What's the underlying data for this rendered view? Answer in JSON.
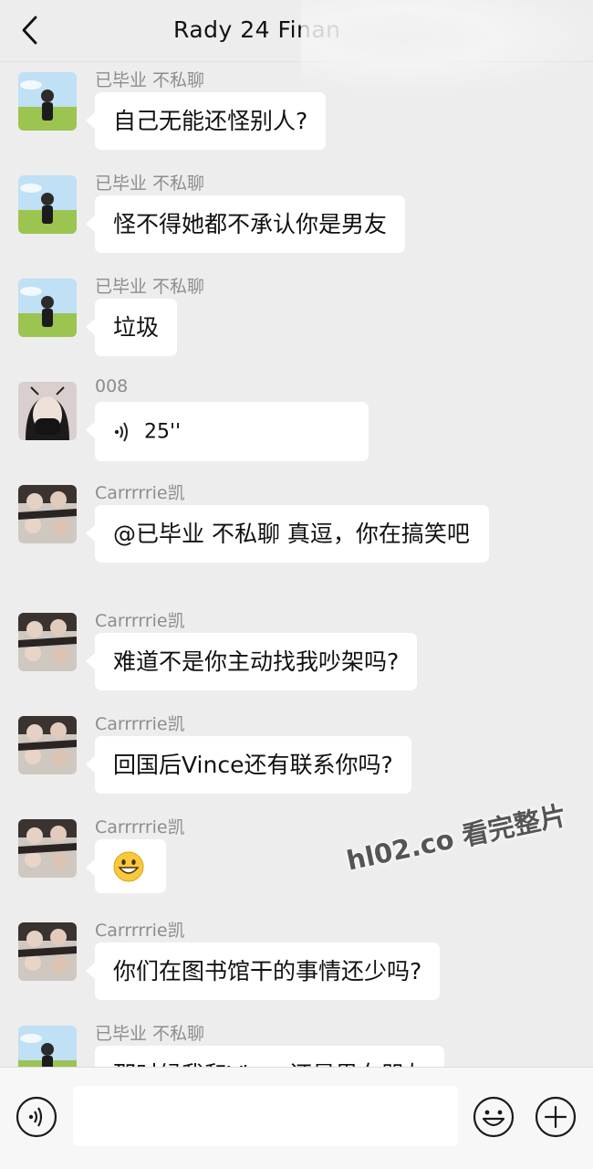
{
  "header": {
    "title": "Rady 24 Finan",
    "back_icon": "chevron-left-icon"
  },
  "messages": [
    {
      "sender": "已毕业 不私聊",
      "text": "自己无能还怪别人?",
      "avatar": "girl-meadow-avatar"
    },
    {
      "sender": "已毕业 不私聊",
      "text": "怪不得她都不承认你是男友",
      "avatar": "girl-meadow-avatar"
    },
    {
      "sender": "已毕业 不私聊",
      "text": "垃圾",
      "avatar": "girl-meadow-avatar"
    },
    {
      "sender": "008",
      "voice_duration": "25''",
      "avatar": "girl-mask-avatar",
      "type": "voice"
    },
    {
      "sender": "Carrrrrie凯",
      "text": "@已毕业 不私聊 真逗，你在搞笑吧",
      "avatar": "group-photo-avatar"
    },
    {
      "sender": "Carrrrrie凯",
      "text": "难道不是你主动找我吵架吗?",
      "avatar": "group-photo-avatar"
    },
    {
      "sender": "Carrrrrie凯",
      "text": "回国后Vince还有联系你吗?",
      "avatar": "group-photo-avatar"
    },
    {
      "sender": "Carrrrrie凯",
      "emoji": "grinning-face",
      "avatar": "group-photo-avatar",
      "type": "emoji"
    },
    {
      "sender": "Carrrrrie凯",
      "text": "你们在图书馆干的事情还少吗?",
      "avatar": "group-photo-avatar"
    },
    {
      "sender": "已毕业 不私聊",
      "text": "那时候我和Vince还是男女朋友",
      "avatar": "girl-meadow-avatar"
    }
  ],
  "watermark": "hl02.co 看完整片",
  "input_bar": {
    "voice_icon": "voice-mode-icon",
    "input_value": "",
    "emoji_icon": "emoji-icon",
    "plus_icon": "plus-icon"
  },
  "colors": {
    "background": "#ededed",
    "bubble": "#ffffff",
    "sender_name": "#8d8d8d"
  }
}
